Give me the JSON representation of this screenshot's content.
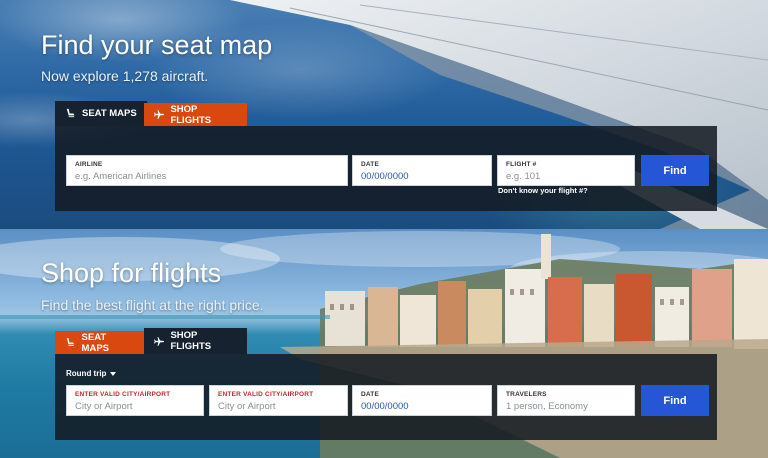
{
  "seat_map_section": {
    "title": "Find your seat map",
    "subtitle": "Now explore 1,278 aircraft.",
    "tabs": {
      "seat_maps": "SEAT MAPS",
      "shop_flights": "SHOP FLIGHTS"
    },
    "fields": {
      "airline": {
        "label": "AIRLINE",
        "placeholder": "e.g. American Airlines"
      },
      "date": {
        "label": "DATE",
        "value": "00/00/0000"
      },
      "flight": {
        "label": "FLIGHT #",
        "placeholder": "e.g. 101"
      }
    },
    "help_link": "Don't know your flight #?",
    "find_label": "Find"
  },
  "shop_section": {
    "title": "Shop for flights",
    "subtitle": "Find the best flight at the right price.",
    "tabs": {
      "seat_maps": "SEAT MAPS",
      "shop_flights": "SHOP FLIGHTS"
    },
    "trip_type": "Round trip",
    "fields": {
      "origin": {
        "label": "ENTER VALID CITY/AIRPORT",
        "placeholder": "City or Airport"
      },
      "destination": {
        "label": "ENTER VALID CITY/AIRPORT",
        "placeholder": "City or Airport"
      },
      "date": {
        "label": "DATE",
        "value": "00/00/0000"
      },
      "travelers": {
        "label": "TRAVELERS",
        "value": "1 person, Economy"
      }
    },
    "find_label": "Find"
  },
  "colors": {
    "accent_orange": "#d9480f",
    "find_blue": "#2456d6",
    "tab_dark": "#16222f",
    "error_red": "#c0282d"
  },
  "icons": {
    "seat": "seat-icon",
    "plane": "plane-icon",
    "caret": "chevron-down-icon"
  }
}
